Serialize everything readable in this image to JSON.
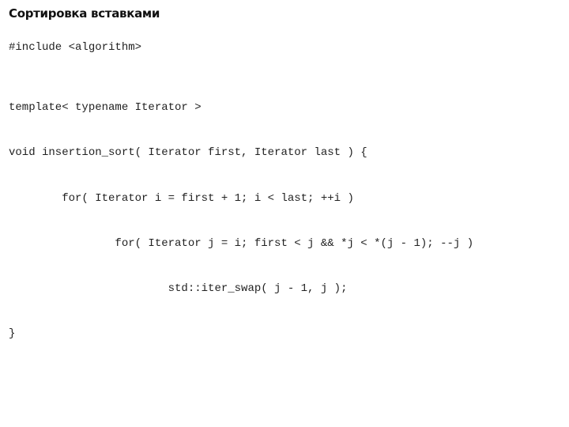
{
  "title": "Сортировка вставками",
  "code": {
    "include": "#include <algorithm>",
    "lines": [
      "template< typename Iterator >",
      "void insertion_sort( Iterator first, Iterator last ) {",
      "        for( Iterator i = first + 1; i < last; ++i )",
      "                for( Iterator j = i; first < j && *j < *(j - 1); --j )",
      "                        std::iter_swap( j - 1, j );",
      "}"
    ]
  }
}
